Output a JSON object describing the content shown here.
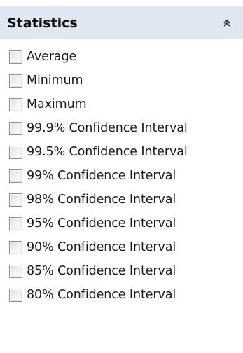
{
  "panel": {
    "title": "Statistics",
    "collapse_icon": "double-chevron-up-icon"
  },
  "options": [
    {
      "label": "Average",
      "checked": false
    },
    {
      "label": "Minimum",
      "checked": false
    },
    {
      "label": "Maximum",
      "checked": false
    },
    {
      "label": "99.9% Confidence Interval",
      "checked": false
    },
    {
      "label": "99.5% Confidence Interval",
      "checked": false
    },
    {
      "label": "99% Confidence Interval",
      "checked": false
    },
    {
      "label": "98% Confidence Interval",
      "checked": false
    },
    {
      "label": "95% Confidence Interval",
      "checked": false
    },
    {
      "label": "90% Confidence Interval",
      "checked": false
    },
    {
      "label": "85% Confidence Interval",
      "checked": false
    },
    {
      "label": "80% Confidence Interval",
      "checked": false
    }
  ],
  "colors": {
    "header_bg": "#dfe7f0",
    "checkbox_border": "#8f8f8f",
    "text": "#1a1a1a"
  }
}
